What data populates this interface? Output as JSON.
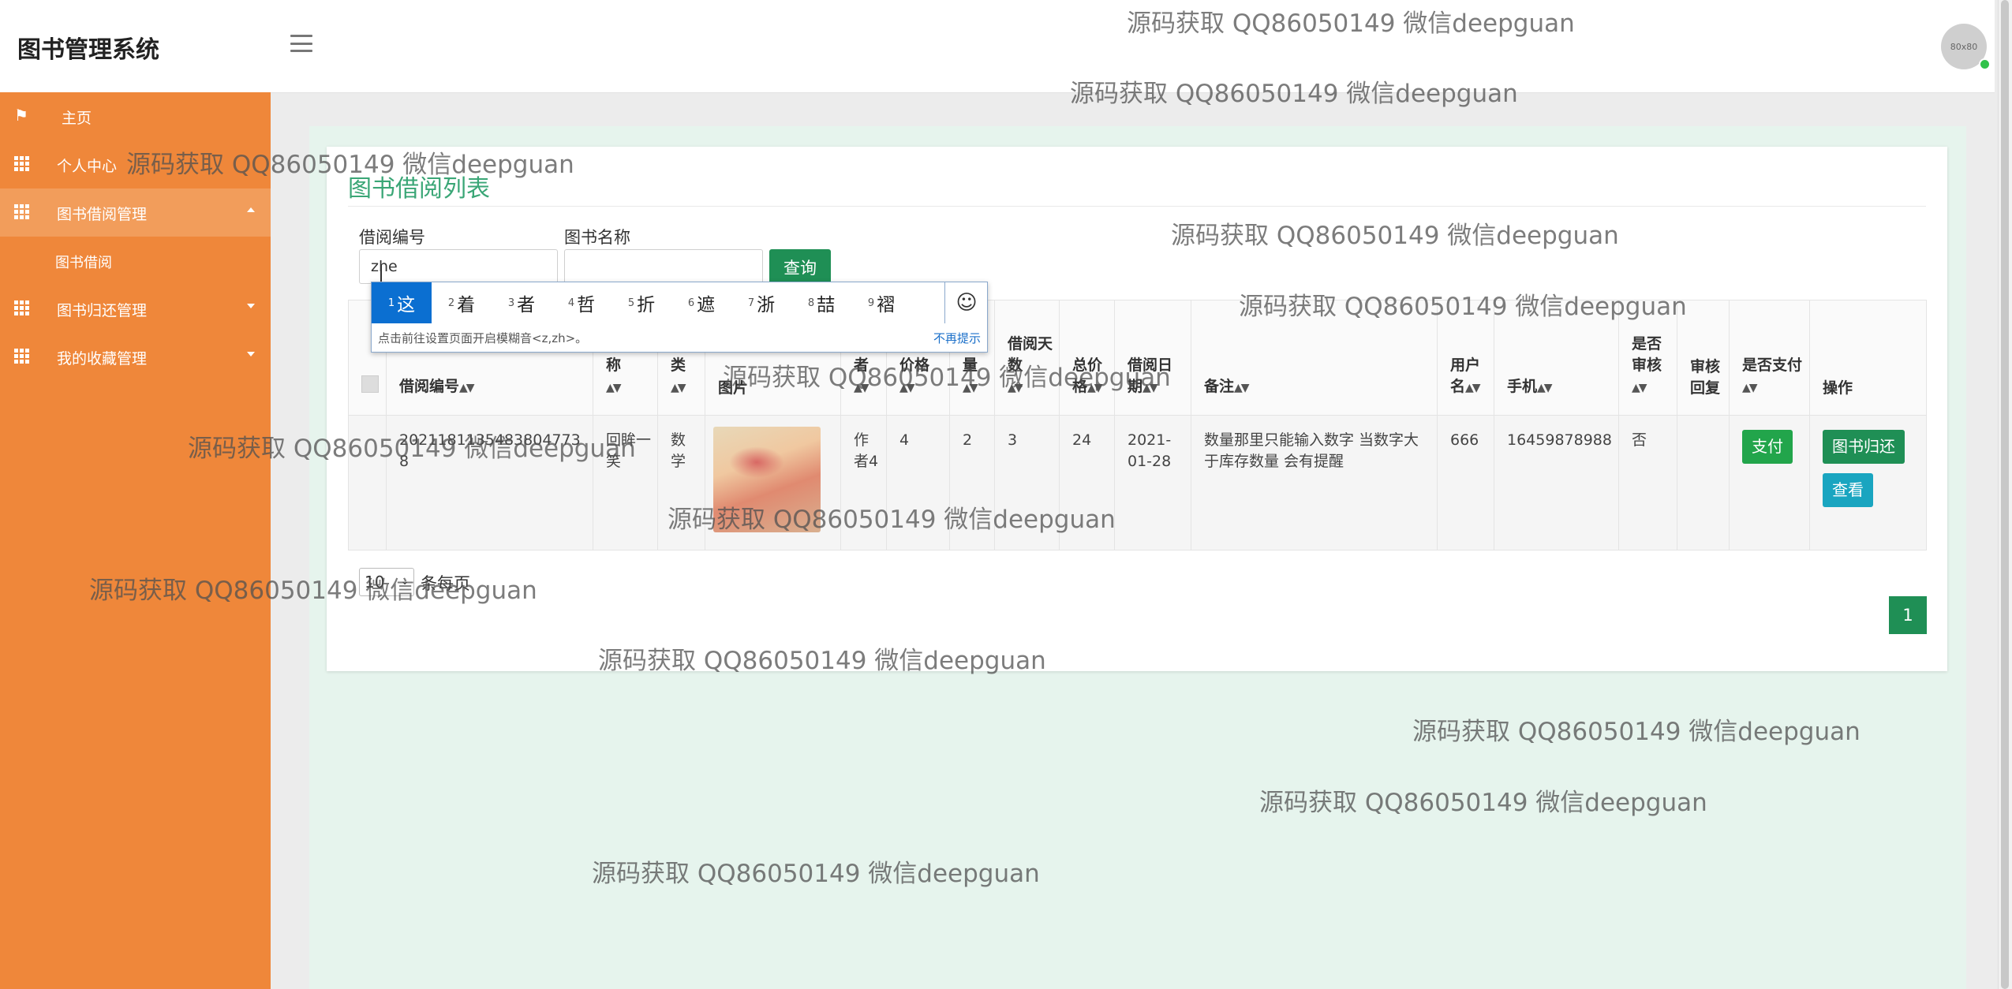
{
  "app": {
    "title": "图书管理系统",
    "avatar_text": "80x80"
  },
  "sidebar": {
    "items": [
      {
        "label": "主页"
      },
      {
        "label": "个人中心"
      },
      {
        "label": "图书借阅管理"
      },
      {
        "label": "图书借阅"
      },
      {
        "label": "图书归还管理"
      },
      {
        "label": "我的收藏管理"
      }
    ]
  },
  "main": {
    "title": "图书借阅列表",
    "search": {
      "borrow_no_label": "借阅编号",
      "borrow_no_value": "zhe",
      "book_name_label": "图书名称",
      "book_name_value": "",
      "query_label": "查询"
    },
    "table": {
      "headers": [
        "借阅编号",
        "图书名称",
        "分类",
        "图片",
        "作者",
        "借阅价格",
        "数量",
        "借阅天数",
        "总价格",
        "借阅日期",
        "备注",
        "用户名",
        "手机",
        "是否审核",
        "审核回复",
        "是否支付",
        "操作"
      ],
      "rows": [
        {
          "borrow_no": "20211811354838047738",
          "book_name": "回眸一笑",
          "category": "数学",
          "author": "作者4",
          "price": "4",
          "quantity": "2",
          "days": "3",
          "total": "24",
          "date": "2021-01-28",
          "remark": "数量那里只能输入数字 当数字大于库存数量 会有提醒",
          "username": "666",
          "phone": "16459878988",
          "audited": "否",
          "audit_reply": "",
          "pay_label": "支付",
          "return_label": "图书归还",
          "view_label": "查看"
        }
      ]
    },
    "pager": {
      "page_size": "10",
      "per_page_label": "条每页",
      "current_page": "1"
    }
  },
  "ime": {
    "candidates": [
      {
        "n": "1",
        "c": "这"
      },
      {
        "n": "2",
        "c": "着"
      },
      {
        "n": "3",
        "c": "者"
      },
      {
        "n": "4",
        "c": "哲"
      },
      {
        "n": "5",
        "c": "折"
      },
      {
        "n": "6",
        "c": "遮"
      },
      {
        "n": "7",
        "c": "浙"
      },
      {
        "n": "8",
        "c": "喆"
      },
      {
        "n": "9",
        "c": "褶"
      }
    ],
    "hint": "点击前往设置页面开启模糊音<z,zh>。",
    "dismiss": "不再提示",
    "emoji": "☺"
  },
  "watermark": "源码获取 QQ86050149 微信deepguan"
}
